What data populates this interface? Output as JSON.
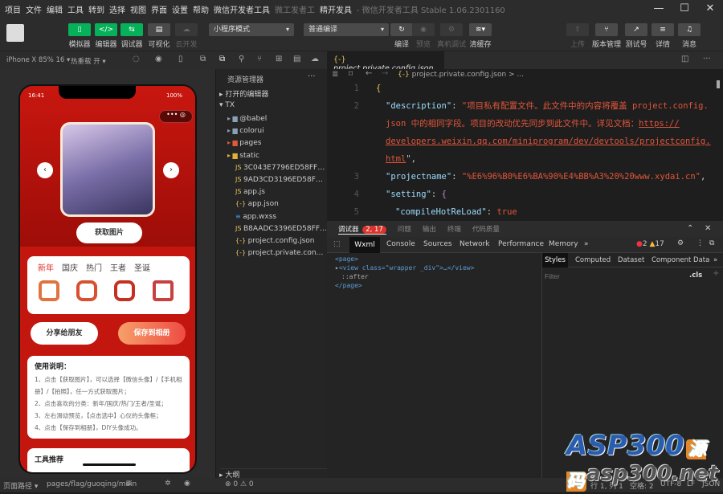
{
  "menu": {
    "items": [
      "项目",
      "文件",
      "编辑",
      "工具",
      "转到",
      "选择",
      "视图",
      "界面",
      "设置",
      "帮助",
      "微信开发者工具"
    ],
    "title_dim": "微工发者工",
    "title_main": "精开发具",
    "title_suffix": "- 微信开发者工具 Stable 1.06.2301160"
  },
  "window": {
    "minimize": "—",
    "maximize": "☐",
    "close": "✕"
  },
  "toolbar": {
    "simulator": "模拟器",
    "editor": "编辑器",
    "debugger": "调试器",
    "visual": "可视化",
    "cloud": "云开发",
    "mode": "小程序模式",
    "compile_mode": "普通编译",
    "compile": "编译",
    "preview": "预览",
    "real_debug": "真机调试",
    "clear_cache": "清缓存",
    "upload": "上传",
    "version": "版本管理",
    "test": "测试号",
    "details": "详情",
    "messages": "消息"
  },
  "subbar": {
    "device": "iPhone X 85% 16 ▾",
    "hot_reload": "热重载 开 ▾",
    "tab_file": "project.private.config.json"
  },
  "phone": {
    "time": "16:41",
    "battery": "100%",
    "get_image": "获取图片",
    "categories": [
      "新年",
      "国庆",
      "热门",
      "王者",
      "圣诞"
    ],
    "share": "分享给朋友",
    "save": "保存到相册",
    "usage_title": "使用说明：",
    "usage": [
      "1、点击【获取图片】，可以选择【微信头像】/【手机相册】/【拍照】，任一方式获取图片；",
      "2、点击喜欢的分类：新年/国庆/热门/王者/圣诞；",
      "3、左右滑动预览，【点击选中】心仪的头像框；",
      "4、点击【保存到相册】，DIY头像成功。"
    ],
    "tools_title": "工具推荐"
  },
  "explorer": {
    "title": "资源管理器",
    "more": "···",
    "open_editors": "打开的编辑器",
    "root": "TX",
    "files": [
      {
        "name": "@babel",
        "type": "folder"
      },
      {
        "name": "colorui",
        "type": "folder"
      },
      {
        "name": "pages",
        "type": "folder-pages"
      },
      {
        "name": "static",
        "type": "folder-static"
      },
      {
        "name": "3C043E7796ED58FF5A...",
        "type": "js"
      },
      {
        "name": "9AD3CD3196ED58FFF...",
        "type": "js"
      },
      {
        "name": "app.js",
        "type": "js"
      },
      {
        "name": "app.json",
        "type": "json"
      },
      {
        "name": "app.wxss",
        "type": "wxss"
      },
      {
        "name": "B8AADC3396ED58FFD...",
        "type": "js"
      },
      {
        "name": "project.config.json",
        "type": "json"
      },
      {
        "name": "project.private.config.js...",
        "type": "json"
      }
    ],
    "outline": "大纲"
  },
  "editor": {
    "breadcrumb": "project.private.config.json > ...",
    "lines": [
      "1",
      "2",
      "3",
      "4",
      "5"
    ],
    "code": {
      "l1": "{",
      "desc_key": "\"description\"",
      "desc_val1": "\"项目私有配置文件。此文件中的内容将覆盖 project.config.",
      "desc_val2": "json 中的相同字段。项目的改动优先同步到此文件中。详见文档：",
      "link1": "https://",
      "link2": "developers.weixin.qq.com/miniprogram/dev/devtools/projectconfig.",
      "link3": "html",
      "desc_end": "\",",
      "pn_key": "\"projectname\"",
      "pn_val": "\"%E6%96%B0%E6%BA%90%E4%BB%A3%20%20www.xydai.cn\"",
      "setting_key": "\"setting\"",
      "hot_key": "\"compileHotReLoad\"",
      "hot_val": "true"
    }
  },
  "devtools": {
    "tabs": [
      "调试器",
      "问题",
      "输出",
      "终端",
      "代码质量"
    ],
    "badge": "2, 17",
    "panel_tabs": [
      "Wxml",
      "Console",
      "Sources",
      "Network",
      "Performance",
      "Memory",
      "»"
    ],
    "errors": "2",
    "warnings": "17",
    "wxml": [
      "<page>",
      "<view class=\"wrapper _div\">…</view>",
      "::after",
      "</page>"
    ],
    "style_tabs": [
      "Styles",
      "Computed",
      "Dataset",
      "Component Data",
      "»"
    ],
    "filter_placeholder": "Filter",
    "cls": ".cls",
    "plus": "+"
  },
  "status": {
    "path_label": "页面路径 ▾",
    "path": "pages/flag/guoqing/main",
    "problems": "⊗ 0 ⚠ 0",
    "pos": "行 1, 列 1",
    "spaces": "空格: 2",
    "encoding": "UTF-8",
    "eol": "LF",
    "lang": "JSON"
  },
  "watermark": {
    "brand": "ASP300",
    "brand_cn": "源码",
    "url": "asp300.net"
  }
}
